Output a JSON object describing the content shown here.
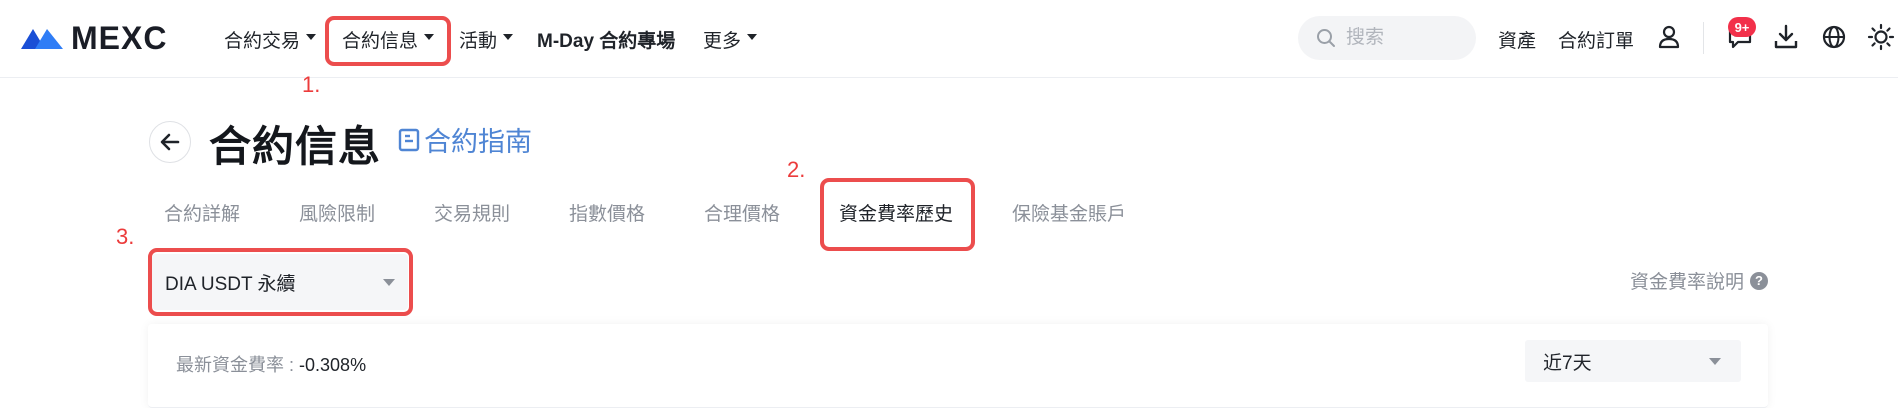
{
  "brand": {
    "logo_text": "MEXC",
    "logo_color": "#1d6ff2"
  },
  "nav": {
    "items": [
      {
        "label": "合約交易",
        "has_caret": true
      },
      {
        "label": "合約信息",
        "has_caret": true
      },
      {
        "label": "活動",
        "has_caret": true
      },
      {
        "label": "M-Day 合約專場",
        "has_caret": false
      },
      {
        "label": "更多",
        "has_caret": true
      }
    ]
  },
  "search": {
    "placeholder": "搜索"
  },
  "header_right": {
    "assets_label": "資產",
    "orders_label": "合約訂單",
    "notification_badge": "9+",
    "icons": [
      "user-icon",
      "message-icon",
      "download-icon",
      "globe-icon",
      "theme-sun-icon"
    ]
  },
  "annotations": {
    "one": "1.",
    "two": "2.",
    "three": "3.",
    "box_color": "#ec4d4d"
  },
  "page": {
    "title": "合約信息",
    "guide_label": "合約指南",
    "tabs": [
      {
        "label": "合約詳解"
      },
      {
        "label": "風險限制"
      },
      {
        "label": "交易規則"
      },
      {
        "label": "指數價格"
      },
      {
        "label": "合理價格"
      },
      {
        "label": "資金費率歷史",
        "active": true
      },
      {
        "label": "保險基金賬戶"
      }
    ],
    "contract_select": {
      "value": "DIA USDT 永續"
    },
    "explain_label": "資金費率說明",
    "latest_rate_label": "最新資金費率 :",
    "latest_rate_value": "-0.308%",
    "period_select": {
      "value": "近7天"
    }
  }
}
